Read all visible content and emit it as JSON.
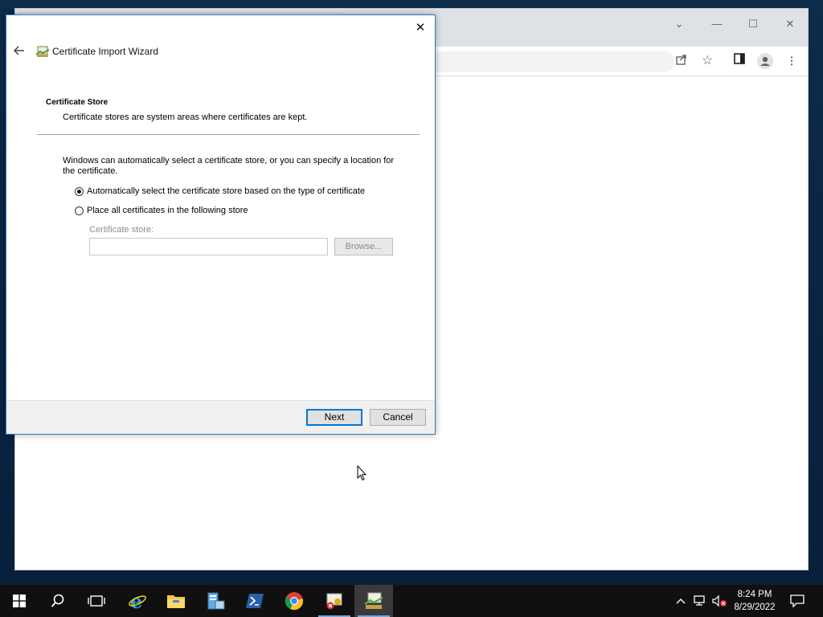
{
  "dialog": {
    "title": "Certificate Import Wizard",
    "heading": "Certificate Store",
    "subheading": "Certificate stores are system areas where certificates are kept.",
    "intro": "Windows can automatically select a certificate store, or you can specify a location for the certificate.",
    "radio_auto": "Automatically select the certificate store based on the type of certificate",
    "radio_manual": "Place all certificates in the following store",
    "store_label": "Certificate store:",
    "store_value": "",
    "browse_label": "Browse...",
    "next_label": "Next",
    "cancel_label": "Cancel",
    "selected_option": "auto"
  },
  "taskbar": {
    "time": "8:24 PM",
    "date": "8/29/2022",
    "apps": [
      "start-icon",
      "search-icon",
      "task-view-icon",
      "internet-explorer-icon",
      "file-explorer-icon",
      "server-manager-icon",
      "powershell-icon",
      "chrome-icon",
      "certificate-manager-icon",
      "certificate-import-icon"
    ]
  },
  "colors": {
    "accent": "#0078d7",
    "taskbar": "#101010",
    "desktop": "#0b2540"
  }
}
